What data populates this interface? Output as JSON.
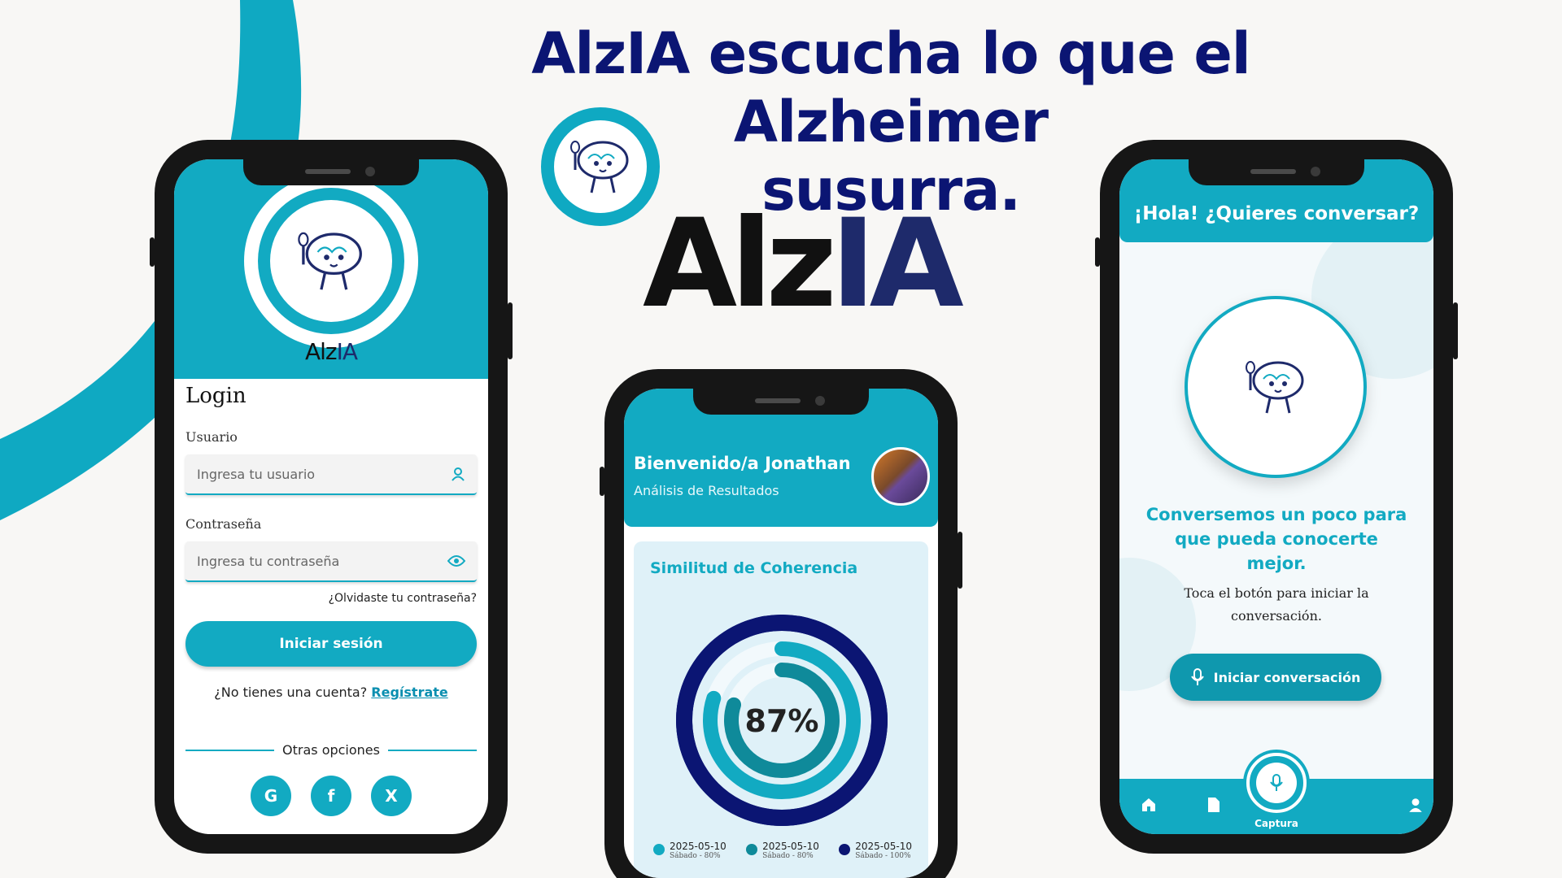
{
  "headline": {
    "line1": "AlzIA escucha lo que el Alzheimer",
    "line2": "susurra."
  },
  "brand": {
    "part1": "Alz",
    "part2": "IA"
  },
  "colors": {
    "teal": "#12aac2",
    "navy": "#0b1573",
    "dark": "#111111"
  },
  "login_screen": {
    "brand_part1": "Alz",
    "brand_part2": "IA",
    "title": "Login",
    "username_label": "Usuario",
    "username_placeholder": "Ingresa tu usuario",
    "password_label": "Contraseña",
    "password_placeholder": "Ingresa tu contraseña",
    "forgot": "¿Olvidaste tu contraseña?",
    "login_button": "Iniciar sesión",
    "no_account": "¿No tienes una cuenta?",
    "signup_link": "Regístrate",
    "other_options": "Otras opciones",
    "social": [
      {
        "icon": "google-icon",
        "glyph": "G"
      },
      {
        "icon": "facebook-icon",
        "glyph": "f"
      },
      {
        "icon": "x-icon",
        "glyph": "X"
      }
    ]
  },
  "results_screen": {
    "greeting": "Bienvenido/a Jonathan",
    "subtitle": "Análisis de Resultados",
    "card_title": "Similitud de Coherencia",
    "center_value": "87%",
    "legend": [
      {
        "date": "2025-05-10",
        "detail": "Sábado - 80%",
        "color": "#12aac2"
      },
      {
        "date": "2025-05-10",
        "detail": "Sábado - 80%",
        "color": "#0f8a9a"
      },
      {
        "date": "2025-05-10",
        "detail": "Sábado - 100%",
        "color": "#0b1573"
      }
    ]
  },
  "chart_data": {
    "type": "radial-bar",
    "center_label": "87%",
    "series": [
      {
        "name": "2025-05-10 Sábado - 100%",
        "value": 100,
        "color": "#0b1573"
      },
      {
        "name": "2025-05-10 Sábado - 80%",
        "value": 80,
        "color": "#12aac2"
      },
      {
        "name": "2025-05-10 Sábado - 80%",
        "value": 80,
        "color": "#0f8a9a"
      }
    ]
  },
  "chat_screen": {
    "title": "¡Hola! ¿Quieres conversar?",
    "message": "Conversemos un poco para que pueda conocerte mejor.",
    "hint": "Toca el botón para iniciar la conversación.",
    "start_button": "Iniciar conversación",
    "nav": {
      "capture_label": "Captura"
    }
  }
}
